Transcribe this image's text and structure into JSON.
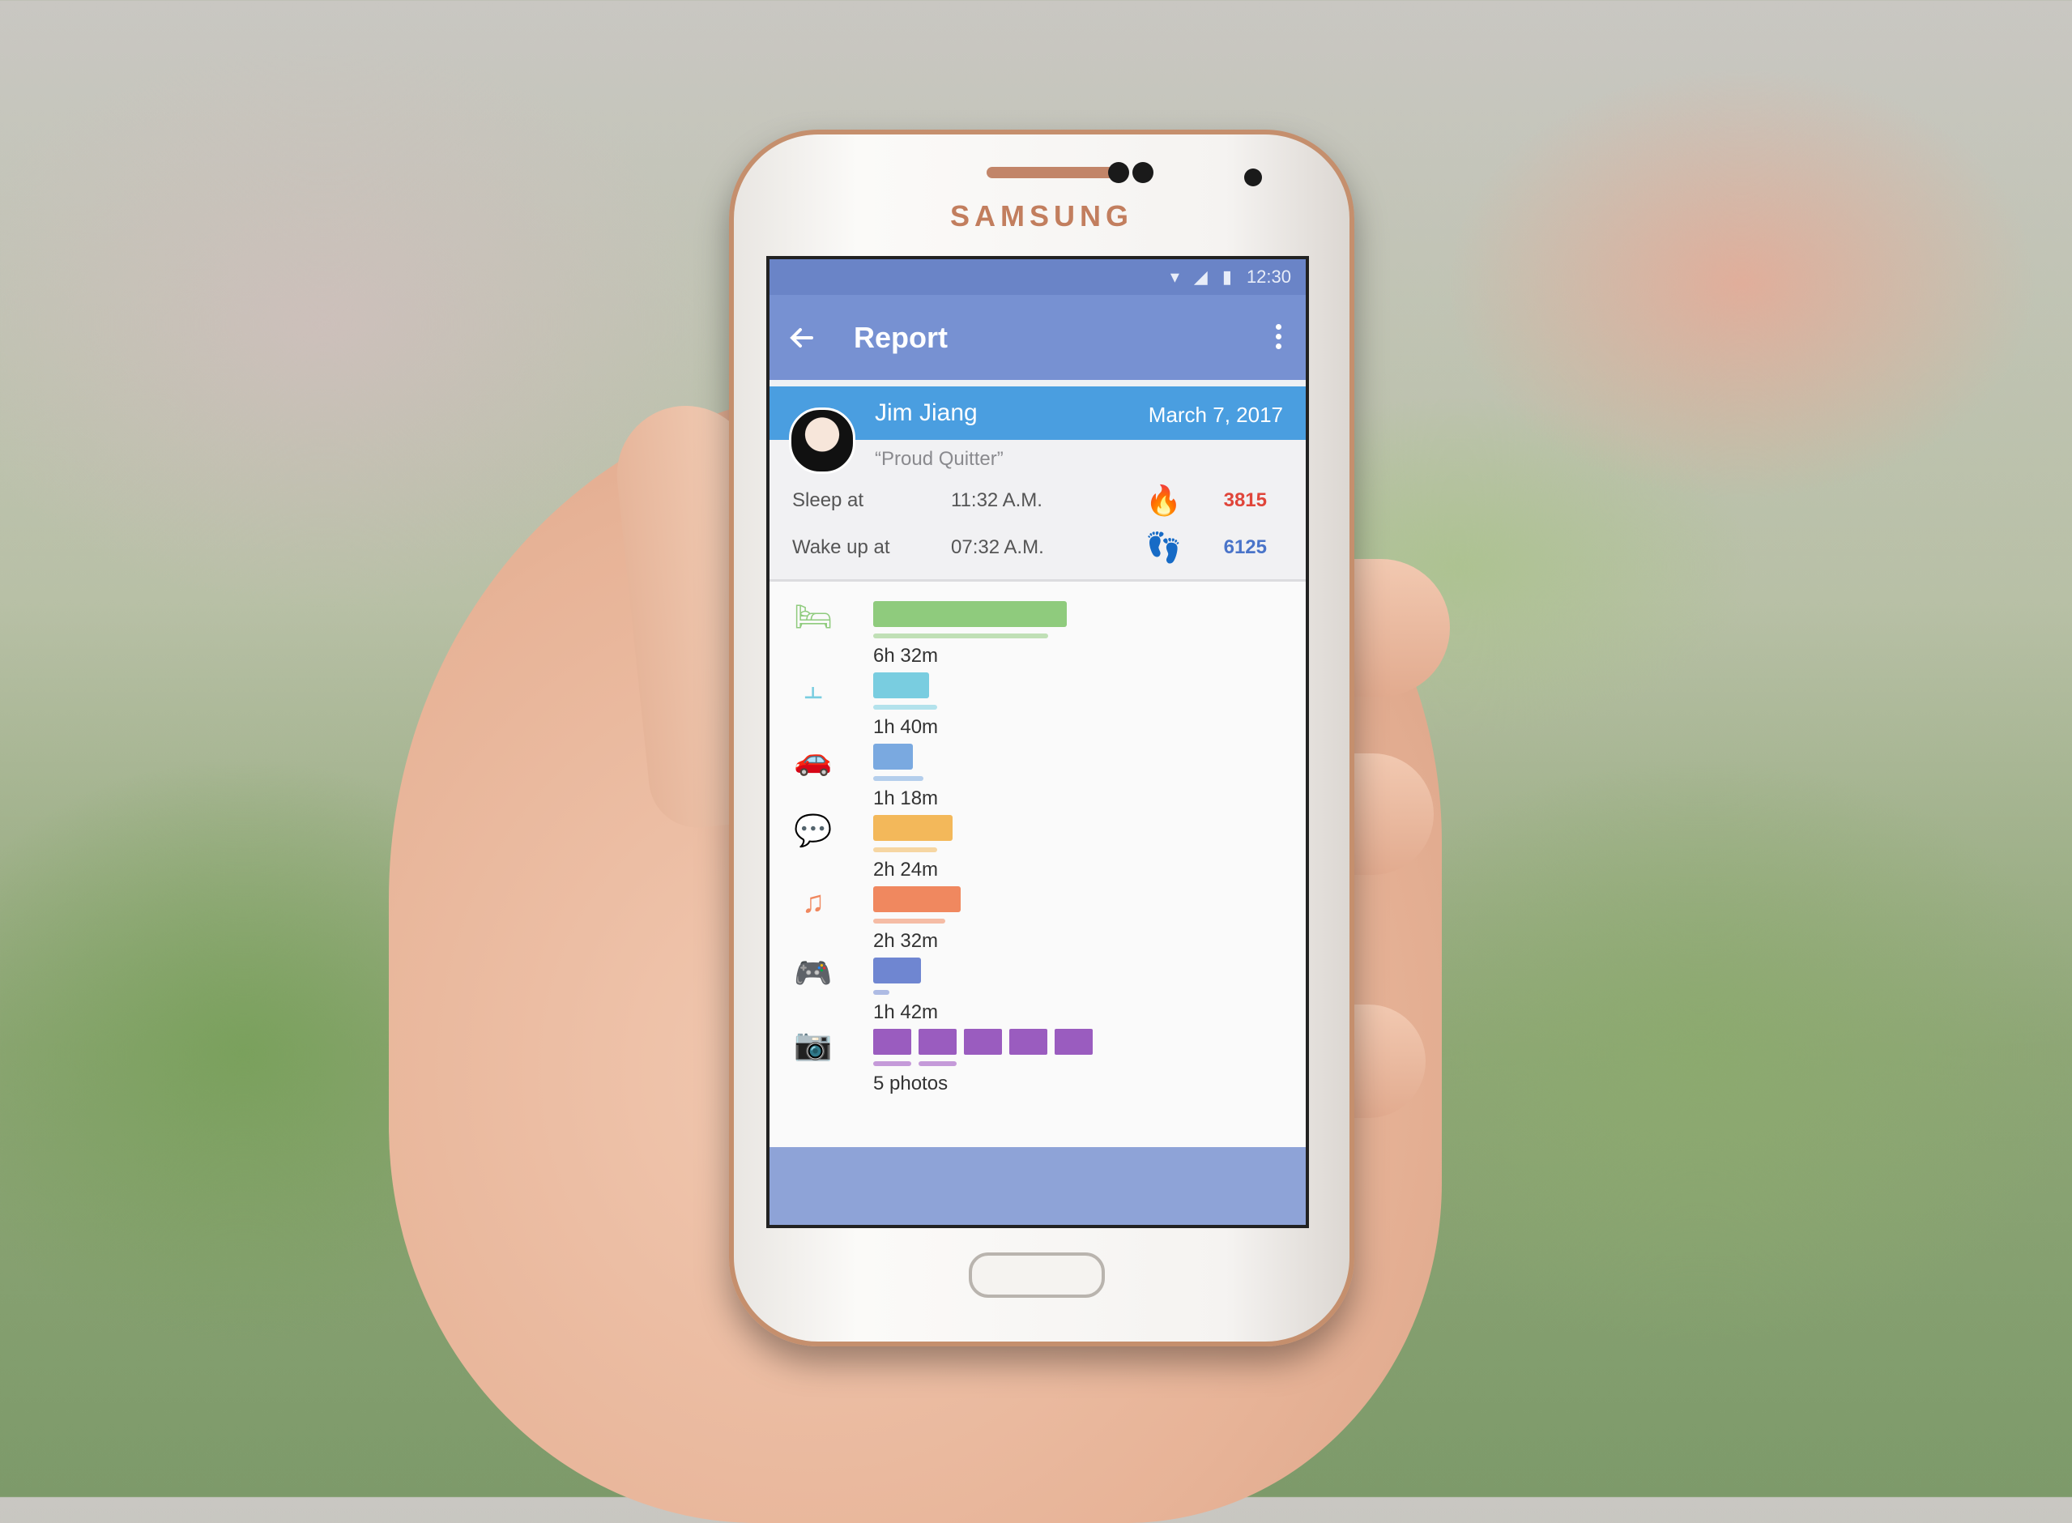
{
  "device": {
    "brand": "SAMSUNG"
  },
  "status_bar": {
    "time": "12:30"
  },
  "app_bar": {
    "title": "Report"
  },
  "profile": {
    "name": "Jim Jiang",
    "date": "March 7, 2017",
    "motto": "“Proud Quitter”"
  },
  "stats": {
    "sleep": {
      "label": "Sleep at",
      "time": "11:32 A.M.",
      "icon": "flame-icon",
      "value": "3815",
      "color": "#e0453a"
    },
    "wake": {
      "label": "Wake up at",
      "time": "07:32 A.M.",
      "icon": "footsteps-icon",
      "value": "6125",
      "color": "#4a74c9"
    }
  },
  "activities": [
    {
      "icon": "bed-icon",
      "label": "6h 32m",
      "color": "#8fcb7d",
      "bar_fraction": 0.97,
      "sub_fraction": 0.88
    },
    {
      "icon": "dumbbell-icon",
      "label": "1h 40m",
      "color": "#79cde0",
      "bar_fraction": 0.28,
      "sub_fraction": 0.32
    },
    {
      "icon": "car-icon",
      "label": "1h 18m",
      "color": "#7aa9e0",
      "bar_fraction": 0.2,
      "sub_fraction": 0.25
    },
    {
      "icon": "chat-icon",
      "label": "2h 24m",
      "color": "#f3b85a",
      "bar_fraction": 0.4,
      "sub_fraction": 0.32
    },
    {
      "icon": "music-note-icon",
      "label": "2h 32m",
      "color": "#f0885f",
      "bar_fraction": 0.44,
      "sub_fraction": 0.36
    },
    {
      "icon": "gamepad-icon",
      "label": "1h 42m",
      "color": "#6f86d1",
      "bar_fraction": 0.24,
      "sub_fraction": 0.08
    }
  ],
  "photos": {
    "icon": "camera-icon",
    "label": "5 photos",
    "count": 5,
    "color": "#9a5cbf"
  }
}
